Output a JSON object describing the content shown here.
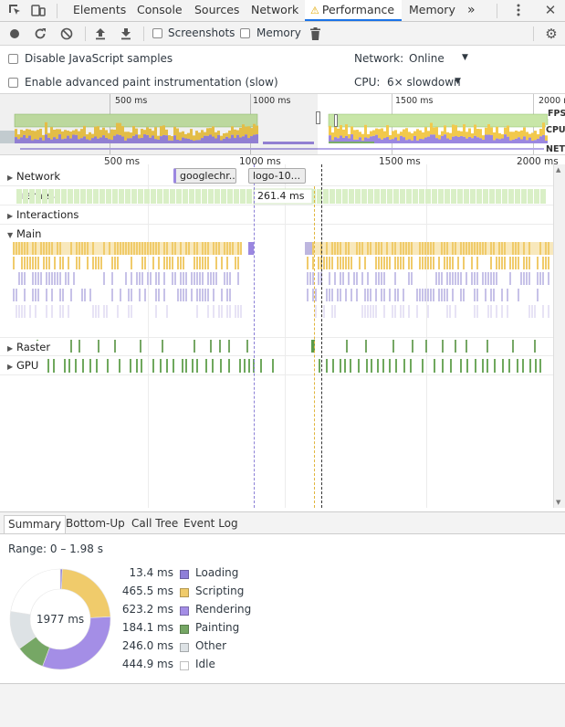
{
  "tabs": {
    "items": [
      "Elements",
      "Console",
      "Sources",
      "Network",
      "Performance",
      "Memory"
    ],
    "selected": "Performance",
    "more": "»"
  },
  "toolbar": {
    "screenshots_label": "Screenshots",
    "memory_label": "Memory"
  },
  "settings": {
    "disable_js_label": "Disable JavaScript samples",
    "advanced_paint_label": "Enable advanced paint instrumentation (slow)",
    "network_label": "Network:",
    "network_value": "Online",
    "cpu_label": "CPU:",
    "cpu_value": "6× slowdown"
  },
  "overview": {
    "ticks": [
      "500 ms",
      "1000 ms",
      "1500 ms",
      "2000 ms"
    ],
    "fps_label": "FPS",
    "cpu_label": "CPU",
    "net_label": "NET",
    "selection": [
      0.0,
      1.98
    ],
    "colors": {
      "fps": "#c8e6a8",
      "scripting": "#f2c94c",
      "rendering": "#9b87e0",
      "painting": "#7aac6b",
      "other": "#cfd8dc"
    }
  },
  "flamechart": {
    "ticks": [
      "500 ms",
      "1000 ms",
      "1500 ms",
      "2000 ms"
    ],
    "tracks": {
      "network": "Network",
      "frames": "Frames",
      "interactions": "Interactions",
      "main": "Main",
      "raster": "Raster",
      "gpu": "GPU"
    },
    "network_chips": [
      "googlechr...",
      "logo-10..."
    ],
    "frame_duration": "261.4 ms"
  },
  "bottom_tabs": {
    "items": [
      "Summary",
      "Bottom-Up",
      "Call Tree",
      "Event Log"
    ],
    "selected": "Summary"
  },
  "summary": {
    "range": "Range: 0 – 1.98 s",
    "total": "1977 ms",
    "categories": [
      {
        "name": "Loading",
        "value": "13.4 ms",
        "ms": 13.4,
        "color": "#8f7fd9"
      },
      {
        "name": "Scripting",
        "value": "465.5 ms",
        "ms": 465.5,
        "color": "#f0cb6b"
      },
      {
        "name": "Rendering",
        "value": "623.2 ms",
        "ms": 623.2,
        "color": "#a48ee6"
      },
      {
        "name": "Painting",
        "value": "184.1 ms",
        "ms": 184.1,
        "color": "#76a765"
      },
      {
        "name": "Other",
        "value": "246.0 ms",
        "ms": 246.0,
        "color": "#dde2e5"
      },
      {
        "name": "Idle",
        "value": "444.9 ms",
        "ms": 444.9,
        "color": "#ffffff"
      }
    ]
  }
}
